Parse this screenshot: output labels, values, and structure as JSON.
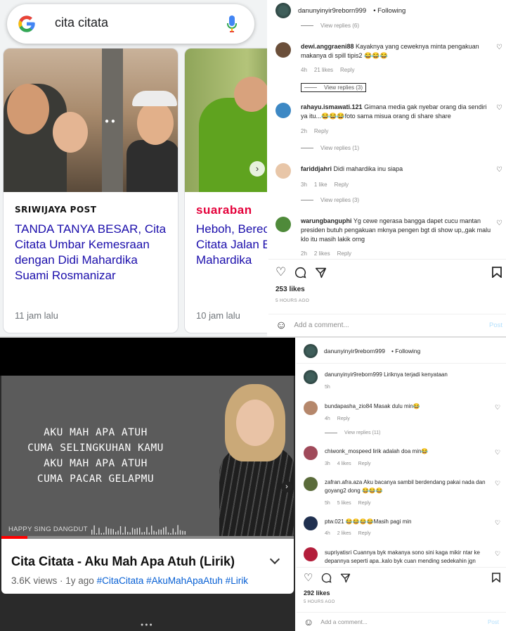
{
  "google": {
    "query": "cita citata",
    "cards": [
      {
        "source": "SRIWIJAYA POST",
        "title": "TANDA TANYA BESAR, Cita Citata Umbar Kemesraan dengan Didi Mahardika Suami Rosmanizar",
        "time": "11 jam lalu"
      },
      {
        "source": "suaraban",
        "title": "Heboh, Berec Citata Jalan B Mahardika",
        "time": "10 jam lalu"
      }
    ]
  },
  "ig1": {
    "username": "danunyinyir9reborn999",
    "following": "• Following",
    "top_replies": "View replies (6)",
    "comments": [
      {
        "user": "dewi.anggraeni88",
        "text": "Kayaknya yang ceweknya minta pengakuan makanya di spill tipis2 😂😂😂",
        "time": "4h",
        "likes": "21 likes",
        "reply": "Reply",
        "view": "View replies (3)"
      },
      {
        "user": "rahayu.ismawati.121",
        "text": "Gimana media gak nyebar orang dia sendiri ya itu...😂😂😂foto sama misua orang di share share",
        "time": "2h",
        "likes": "",
        "reply": "Reply",
        "view": "View replies (1)"
      },
      {
        "user": "fariddjahri",
        "text": "Didi mahardika inu siapa",
        "time": "3h",
        "likes": "1 like",
        "reply": "Reply",
        "view": "View replies (3)"
      },
      {
        "user": "warungbanguphi",
        "text": "Yg cewe ngerasa bangga dapet cucu mantan presiden butuh pengakuan mknya pengen bgt di show up,,gak malu klo itu masih lakik orng",
        "time": "2h",
        "likes": "2 likes",
        "reply": "Reply",
        "view": ""
      }
    ],
    "likes": "253 likes",
    "ago": "5 HOURS AGO",
    "add": "Add a comment...",
    "post": "Post"
  },
  "yt": {
    "lyrics": [
      "AKU MAH APA ATUH",
      "CUMA SELINGKUHAN KAMU",
      "AKU MAH APA ATUH",
      "CUMA PACAR GELAPMU"
    ],
    "channel": "HAPPY SING DANGDUT",
    "title": "Cita Citata - Aku Mah Apa Atuh (Lirik)",
    "views": "3.6K views · 1y ago",
    "tags": "#CitaCitata #AkuMahApaAtuh #Lirik",
    "progress": 0.09
  },
  "ig2": {
    "username": "danunyinyir9reborn999",
    "following": "• Following",
    "caption": "Liriknya terjadi kenyataan",
    "caption_time": "5h",
    "comments": [
      {
        "user": "bundapasha_zio84",
        "text": "Masak dulu min😂",
        "time": "4h",
        "likes": "",
        "reply": "Reply",
        "view": "View replies (11)"
      },
      {
        "user": "chiwonk_mospeed",
        "text": "lirik adalah doa min😂",
        "time": "3h",
        "likes": "4 likes",
        "reply": "Reply",
        "view": ""
      },
      {
        "user": "zafran.afra.aza",
        "text": "Aku bacanya sambil berdendang pakai nada dan goyang2 dong 😂😂😂",
        "time": "5h",
        "likes": "5 likes",
        "reply": "Reply",
        "view": ""
      },
      {
        "user": "ptw.021",
        "text": "😂😂😂😂Masih pagi min",
        "time": "4h",
        "likes": "2 likes",
        "reply": "Reply",
        "view": ""
      },
      {
        "user": "supriyatisri",
        "text": "Cuannya byk makanya sono sini kaga mikir ntar ke depannya seperti apa..kalo byk cuan mending sedekahin jgn",
        "time": "",
        "likes": "",
        "reply": "",
        "view": ""
      }
    ],
    "likes": "292 likes",
    "ago": "5 HOURS AGO",
    "add": "Add a comment...",
    "post": "Post"
  }
}
